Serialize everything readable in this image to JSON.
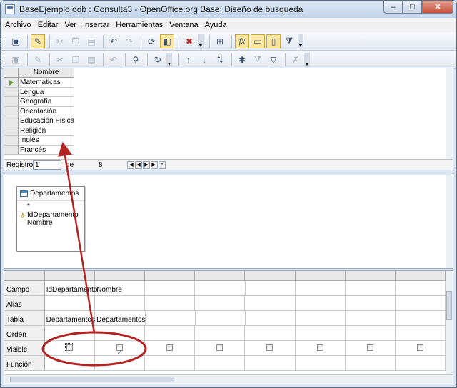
{
  "window": {
    "title": "BaseEjemplo.odb : Consulta3 - OpenOffice.org Base: Diseño de busqueda",
    "minimize": "–",
    "maximize": "□",
    "close": "✕"
  },
  "menu": {
    "items": [
      {
        "label": "Archivo"
      },
      {
        "label": "Editar"
      },
      {
        "label": "Ver"
      },
      {
        "label": "Insertar"
      },
      {
        "label": "Herramientas"
      },
      {
        "label": "Ventana"
      },
      {
        "label": "Ayuda"
      }
    ]
  },
  "toolbar1": {
    "icons": [
      "save-icon",
      "edit-icon",
      "cut-icon",
      "copy-icon",
      "paste-icon",
      "undo-icon",
      "redo-icon",
      "run-query-icon",
      "design-view-icon",
      "clear-query-icon",
      "add-table-icon",
      "functions-icon",
      "table-name-icon",
      "alias-icon",
      "distinct-icon"
    ]
  },
  "toolbar2": {
    "icons": [
      "save-record-icon",
      "edit-data-icon",
      "cut-icon",
      "copy-icon",
      "paste-icon",
      "undo-icon",
      "find-record-icon",
      "refresh-icon",
      "sort-ascending-icon",
      "sort-descending-icon",
      "sort-icon",
      "autofilter-icon",
      "apply-filter-icon",
      "standard-filter-icon",
      "remove-filter-icon"
    ]
  },
  "result": {
    "column_header": "Nombre",
    "rows": [
      "Matemáticas",
      "Lengua",
      "Geografía",
      "Orientación",
      "Educación Física",
      "Religión",
      "Inglés",
      "Francés"
    ],
    "nav": {
      "label": "Registro",
      "current": "1",
      "of": "de",
      "count": "8"
    }
  },
  "design": {
    "table": {
      "name": "Departamentos",
      "fields": [
        "*",
        "IdDepartamento",
        "Nombre"
      ]
    }
  },
  "query_grid": {
    "row_labels": [
      "Campo",
      "Alias",
      "Tabla",
      "Orden",
      "Visible",
      "Función"
    ],
    "columns": [
      {
        "campo": "IdDepartamento",
        "tabla": "Departamentos",
        "visible": false
      },
      {
        "campo": "Nombre",
        "tabla": "Departamentos",
        "visible": true
      },
      {
        "campo": "",
        "tabla": "",
        "visible": false
      },
      {
        "campo": "",
        "tabla": "",
        "visible": false
      },
      {
        "campo": "",
        "tabla": "",
        "visible": false
      },
      {
        "campo": "",
        "tabla": "",
        "visible": false
      },
      {
        "campo": "",
        "tabla": "",
        "visible": false
      },
      {
        "campo": "",
        "tabla": "",
        "visible": false
      }
    ]
  },
  "annotation": {
    "color": "#b22222"
  }
}
